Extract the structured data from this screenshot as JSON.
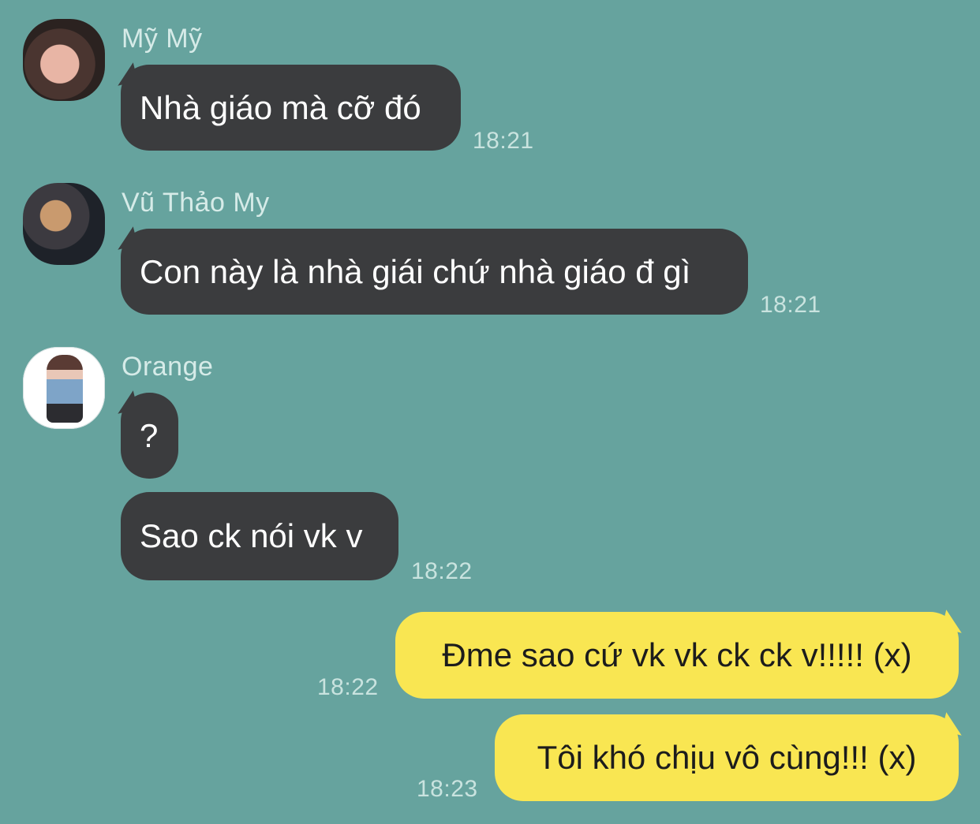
{
  "colors": {
    "background": "#66a39e",
    "incoming_bubble": "#3b3c3e",
    "outgoing_bubble": "#f9e652"
  },
  "messages": [
    {
      "sender": "Mỹ Mỹ",
      "text": "Nhà giáo mà cỡ đó",
      "time": "18:21",
      "avatar_icon": "user-photo-icon"
    },
    {
      "sender": "Vũ Thảo My",
      "text": "Con này là nhà giái chứ nhà giáo đ gì",
      "time": "18:21",
      "avatar_icon": "user-photo-icon"
    },
    {
      "sender": "Orange",
      "text": "?",
      "avatar_icon": "user-photo-icon"
    },
    {
      "text": "Sao ck nói vk v",
      "time": "18:22"
    },
    {
      "text": "Đme sao cứ vk vk ck ck v!!!!! (x)",
      "time": "18:22",
      "outgoing": true
    },
    {
      "text": "Tôi khó chịu vô cùng!!! (x)",
      "time": "18:23",
      "outgoing": true
    }
  ]
}
